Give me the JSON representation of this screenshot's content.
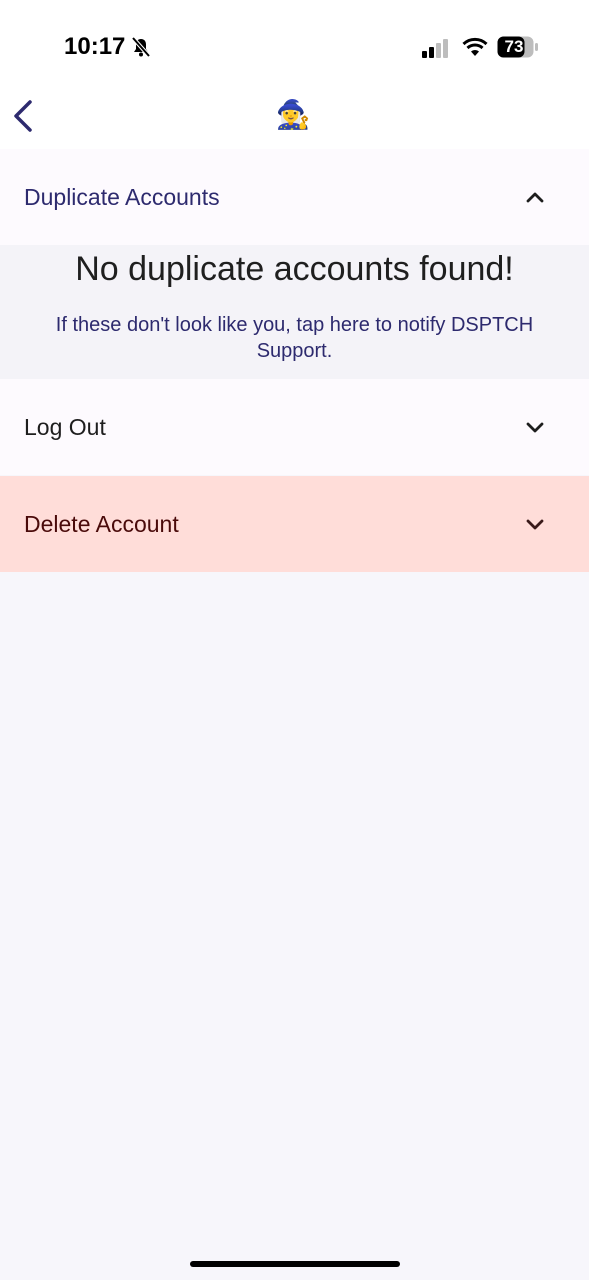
{
  "status_bar": {
    "time": "10:17",
    "battery": "73"
  },
  "nav": {
    "back_icon": "chevron-left-icon",
    "avatar_emoji": "🧙‍♀️"
  },
  "sections": {
    "duplicate_accounts": {
      "label": "Duplicate Accounts",
      "expanded": true,
      "message": "No duplicate accounts found!",
      "notify_text": "If these don't look like you, tap here to notify DSPTCH Support."
    },
    "log_out": {
      "label": "Log Out",
      "expanded": false
    },
    "delete_account": {
      "label": "Delete Account",
      "expanded": false
    }
  },
  "colors": {
    "accent": "#2D2A6E",
    "delete_bg": "#FFDDD9",
    "delete_text": "#4A0A0A"
  }
}
